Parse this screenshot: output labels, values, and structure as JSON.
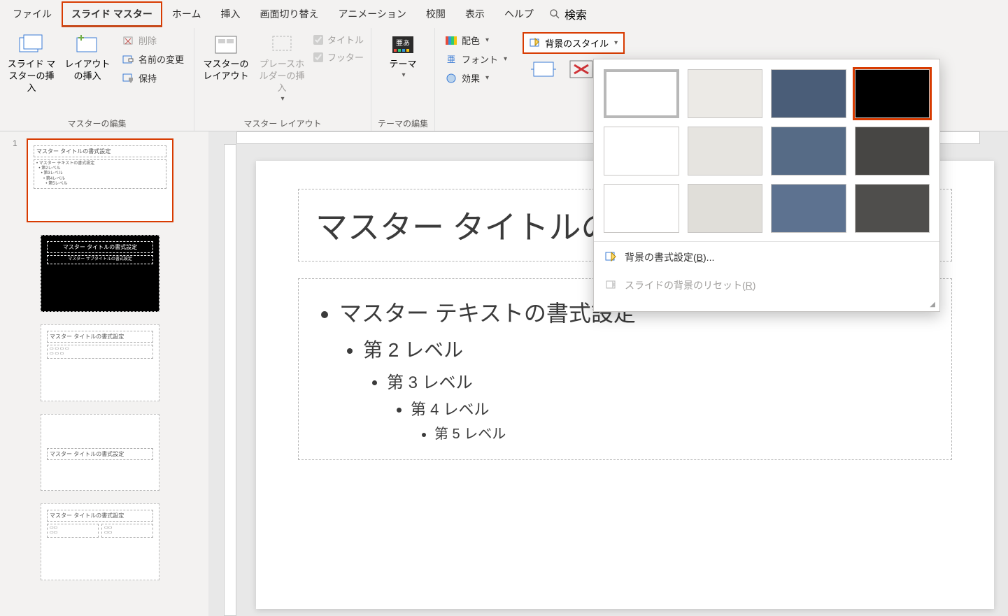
{
  "tabs": {
    "file": "ファイル",
    "slidemaster": "スライド マスター",
    "home": "ホーム",
    "insert": "挿入",
    "transitions": "画面切り替え",
    "animations": "アニメーション",
    "review": "校閲",
    "view": "表示",
    "help": "ヘルプ",
    "search": "検索"
  },
  "ribbon": {
    "edit_master": {
      "insert_slide_master": "スライド マスターの挿入",
      "insert_layout": "レイアウトの挿入",
      "delete": "削除",
      "rename": "名前の変更",
      "preserve": "保持",
      "group_label": "マスターの編集"
    },
    "master_layout": {
      "master_layout": "マスターのレイアウト",
      "insert_placeholder": "プレースホルダーの挿入",
      "title_chk": "タイトル",
      "footer_chk": "フッター",
      "group_label": "マスター レイアウト"
    },
    "edit_theme": {
      "themes": "テーマ",
      "group_label": "テーマの編集"
    },
    "background": {
      "colors": "配色",
      "fonts": "フォント",
      "effects": "効果",
      "bg_styles": "背景のスタイル"
    }
  },
  "popup": {
    "format_bg_pre": "背景の書式設定(",
    "format_bg_accel": "B",
    "format_bg_post": ")...",
    "reset_bg_pre": "スライドの背景のリセット(",
    "reset_bg_accel": "R",
    "reset_bg_post": ")",
    "swatches": [
      {
        "bg": "#ffffff"
      },
      {
        "bg": "#eceae6"
      },
      {
        "bg": "#4a5d78"
      },
      {
        "bg": "#000000"
      },
      {
        "bg": "#ffffff"
      },
      {
        "bg": "#e6e4e0"
      },
      {
        "bg": "#566b86"
      },
      {
        "bg": "#474644"
      },
      {
        "bg": "#ffffff"
      },
      {
        "bg": "#e0ded9"
      },
      {
        "bg": "#5d7290"
      },
      {
        "bg": "#4f4e4c"
      }
    ]
  },
  "nav": {
    "slide_number": "1",
    "master_title": "マスター タイトルの書式設定",
    "master_body": "• マスター テキストの書式設定\n  • 第2レベル\n    • 第3レベル\n      • 第4レベル\n        • 第5レベル",
    "layout_dark_title": "マスター タイトルの書式設定",
    "layout_dark_sub": "マスター サブタイトルの書式設定",
    "layout_generic_title": "マスター タイトルの書式設定"
  },
  "slide": {
    "title": "マスター タイトルの書式設定",
    "lvl1": "マスター テキストの書式設定",
    "lvl2": "第 2 レベル",
    "lvl3": "第 3 レベル",
    "lvl4": "第 4 レベル",
    "lvl5": "第 5 レベル"
  },
  "icons": {
    "colors_sw": [
      "#e74c3c",
      "#2ecc71",
      "#3498db",
      "#f1c40f"
    ]
  }
}
